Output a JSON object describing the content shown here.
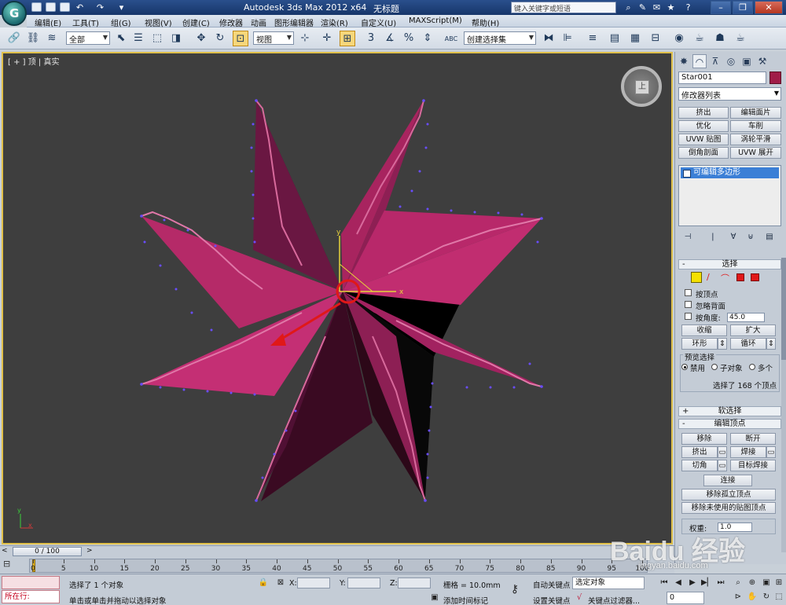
{
  "app": {
    "title": "Autodesk 3ds Max  2012 x64",
    "file": "无标题",
    "search_placeholder": "键入关键字或短语",
    "logo_letter": "G"
  },
  "menu": [
    "编辑(E)",
    "工具(T)",
    "组(G)",
    "视图(V)",
    "创建(C)",
    "修改器",
    "动画",
    "图形编辑器",
    "渲染(R)",
    "自定义(U)",
    "MAXScript(M)",
    "帮助(H)"
  ],
  "toolbar": {
    "filter_value": "全部",
    "ref_coord_value": "视图",
    "selection_set_value": "创建选择集",
    "snap_3_label": "3",
    "percent_label": "%",
    "abc_label": "ABC"
  },
  "viewport": {
    "label": "[ + ] 顶 | 真实",
    "viewcube_label": "上",
    "axis_x": "x",
    "axis_y": "y",
    "mini_axis_y": "y",
    "mini_axis_x": "x",
    "object_color": "#b3225f",
    "vertex_color": "#6a4dff"
  },
  "command_panel": {
    "object_name": "Star001",
    "object_color": "#a01c48",
    "modifier_list": "修改器列表",
    "mod_buttons": [
      "挤出",
      "编辑面片",
      "优化",
      "车削",
      "UVW 贴图",
      "涡轮平滑",
      "倒角剖面",
      "UVW 展开"
    ],
    "stack_item": "可编辑多边形",
    "selection": {
      "title": "选择",
      "by_vertex": "按顶点",
      "ignore_backface": "忽略背面",
      "by_angle": "按角度:",
      "angle_value": "45.0",
      "shrink": "收缩",
      "grow": "扩大",
      "ring": "环形",
      "loop": "循环",
      "preview_title": "预览选择",
      "preview_off": "禁用",
      "preview_subobj": "子对象",
      "preview_multi": "多个",
      "selected_info": "选择了 168 个顶点"
    },
    "soft_selection": "软选择",
    "edit_vertices": {
      "title": "编辑顶点",
      "remove": "移除",
      "break": "断开",
      "extrude": "挤出",
      "weld": "焊接",
      "chamfer": "切角",
      "target_weld": "目标焊接",
      "connect": "连接",
      "remove_isolated": "移除孤立顶点",
      "remove_unused_map": "移除未使用的贴图顶点",
      "weight_label": "权重:",
      "weight_value": "1.0"
    }
  },
  "timeline": {
    "position": "0 / 100",
    "ticks": [
      "0",
      "5",
      "10",
      "15",
      "20",
      "25",
      "30",
      "35",
      "40",
      "45",
      "50",
      "55",
      "60",
      "65",
      "70",
      "75",
      "80",
      "85",
      "90",
      "95",
      "100"
    ]
  },
  "status": {
    "listener_label": "所在行:",
    "selection_info": "选择了 1 个对象",
    "prompt": "单击或单击并拖动以选择对象",
    "x_label": "X:",
    "y_label": "Y:",
    "z_label": "Z:",
    "grid": "栅格 = 10.0mm",
    "add_time_tag": "添加时间标记",
    "auto_key": "自动关键点",
    "set_key": "设置关键点",
    "selected_dd": "选定对象",
    "key_filters": "关键点过滤器...",
    "frame_value": "0"
  },
  "watermark": {
    "brand": "Baidu 经验",
    "url": "jingyan.baidu.com"
  }
}
